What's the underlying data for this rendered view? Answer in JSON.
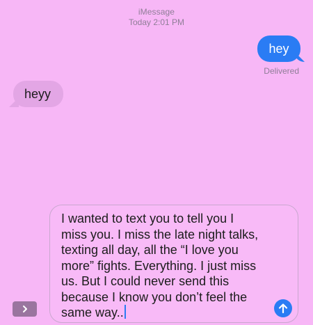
{
  "header": {
    "service": "iMessage",
    "timestamp": "Today 2:01 PM"
  },
  "messages": [
    {
      "direction": "sent",
      "text": "hey"
    },
    {
      "direction": "received",
      "text": "heyy"
    }
  ],
  "status": "Delivered",
  "compose": {
    "text": "I wanted to text you to tell you I\nmiss you. I miss the late night talks,\ntexting all day, all the “I love you\nmore” fights. Everything. I just miss\nus. But I could never send this\nbecause I know you don’t feel the\nsame way.."
  },
  "icons": {
    "send": "arrow-up-icon",
    "apps": "chevron-right-icon"
  },
  "colors": {
    "background": "#f7b7f6",
    "sent_bubble": "#2a7cf4",
    "received_bubble": "#e3a6e5",
    "meta_text": "#8f7e97"
  }
}
